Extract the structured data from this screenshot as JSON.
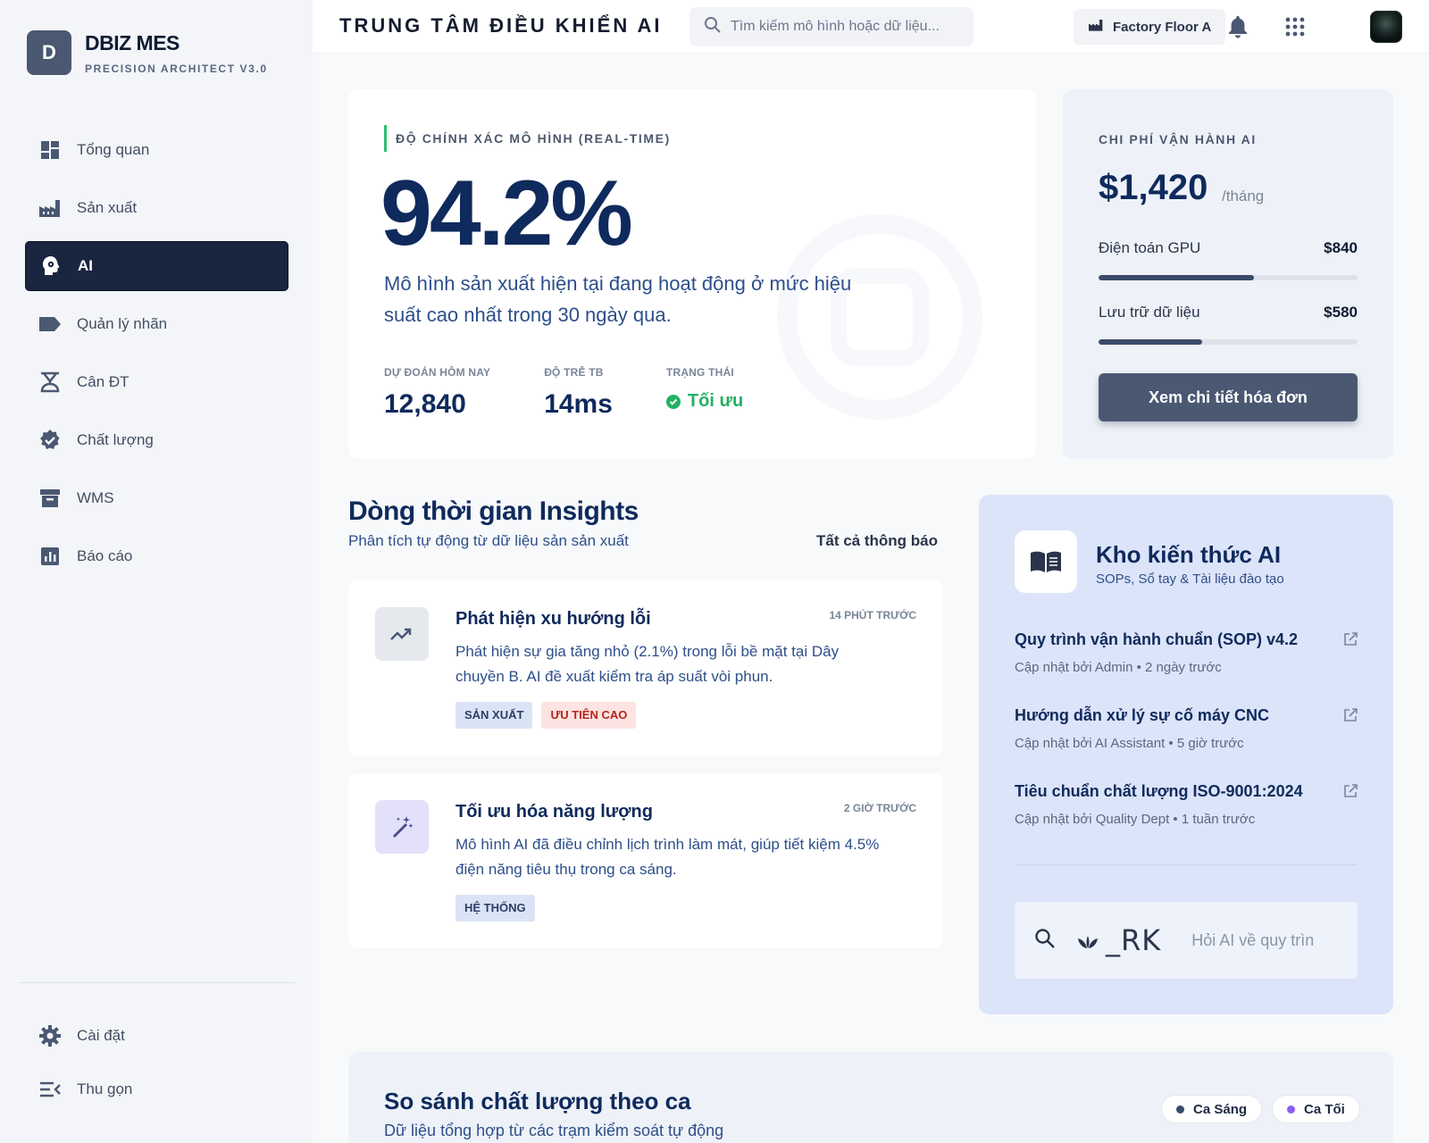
{
  "brand": {
    "logo_letter": "D",
    "name": "DBIZ MES",
    "subtitle": "PRECISION ARCHITECT V3.0"
  },
  "sidebar": {
    "items": [
      {
        "label": "Tổng quan",
        "icon": "dashboard-icon"
      },
      {
        "label": "Sản xuất",
        "icon": "factory-icon"
      },
      {
        "label": "AI",
        "icon": "ai-head-icon",
        "active": true
      },
      {
        "label": "Quản lý nhãn",
        "icon": "label-icon"
      },
      {
        "label": "Cân ĐT",
        "icon": "scale-icon"
      },
      {
        "label": "Chất lượng",
        "icon": "verified-icon"
      },
      {
        "label": "WMS",
        "icon": "archive-icon"
      },
      {
        "label": "Báo cáo",
        "icon": "report-icon"
      }
    ],
    "bottom": [
      {
        "label": "Cài đặt",
        "icon": "gear-icon"
      },
      {
        "label": "Thu gọn",
        "icon": "collapse-icon"
      }
    ]
  },
  "header": {
    "title": "TRUNG TÂM ĐIỀU KHIỂN AI",
    "search_placeholder": "Tìm kiếm mô hình hoặc dữ liệu...",
    "factory_label": "Factory Floor A"
  },
  "accuracy": {
    "label": "ĐỘ CHÍNH XÁC MÔ HÌNH (REAL-TIME)",
    "value": "94.2%",
    "description": "Mô hình sản xuất hiện tại đang hoạt động ở mức hiệu suất cao nhất trong 30 ngày qua.",
    "stats": [
      {
        "label": "DỰ ĐOÁN HÔM NAY",
        "value": "12,840"
      },
      {
        "label": "ĐỘ TRỄ TB",
        "value": "14ms"
      }
    ],
    "status": {
      "label": "TRẠNG THÁI",
      "value": "Tối ưu",
      "color": "#23b064"
    }
  },
  "cost": {
    "label": "CHI PHÍ VẬN HÀNH AI",
    "value": "$1,420",
    "unit": "/tháng",
    "rows": [
      {
        "label": "Điện toán GPU",
        "value": "$840",
        "fraction": 0.6
      },
      {
        "label": "Lưu trữ dữ liệu",
        "value": "$580",
        "fraction": 0.4
      }
    ],
    "button": "Xem chi tiết hóa đơn"
  },
  "insights": {
    "title": "Dòng thời gian Insights",
    "subtitle": "Phân tích tự động từ dữ liệu sản sản xuất",
    "all_link": "Tất cả thông báo",
    "items": [
      {
        "icon": "trending-up-icon",
        "title": "Phát hiện xu hướng lỗi",
        "time": "14 PHÚT TRƯỚC",
        "body": "Phát hiện sự gia tăng nhỏ (2.1%) trong lỗi bề mặt tại Dây chuyền B. AI đề xuất kiểm tra áp suất vòi phun.",
        "tags": [
          "SẢN XUẤT",
          "ƯU TIÊN CAO"
        ]
      },
      {
        "icon": "magic-wand-icon",
        "title": "Tối ưu hóa năng lượng",
        "time": "2 GIỜ TRƯỚC",
        "body": "Mô hình AI đã điều chỉnh lịch trình làm mát, giúp tiết kiệm 4.5% điện năng tiêu thụ trong ca sáng.",
        "tags": [
          "HỆ THỐNG"
        ]
      }
    ]
  },
  "knowledge": {
    "title": "Kho kiến thức AI",
    "subtitle": "SOPs, Sổ tay & Tài liệu đào tạo",
    "items": [
      {
        "title": "Quy trình vận hành chuẩn (SOP) v4.2",
        "meta": "Cập nhật bởi Admin • 2 ngày trước"
      },
      {
        "title": "Hướng dẫn xử lý sự cố máy CNC",
        "meta": "Cập nhật bởi AI Assistant • 5 giờ trước"
      },
      {
        "title": "Tiêu chuẩn chất lượng ISO-9001:2024",
        "meta": "Cập nhật bởi Quality Dept • 1 tuần trước"
      }
    ],
    "ask_brand": "_RK",
    "ask_placeholder": "Hỏi AI về quy trìn"
  },
  "shift": {
    "title": "So sánh chất lượng theo ca",
    "subtitle": "Dữ liệu tổng hợp từ các trạm kiểm soát tự động",
    "legend": [
      {
        "label": "Ca Sáng",
        "color": "#3a4a68"
      },
      {
        "label": "Ca Tối",
        "color": "#8b5cf6"
      }
    ]
  }
}
